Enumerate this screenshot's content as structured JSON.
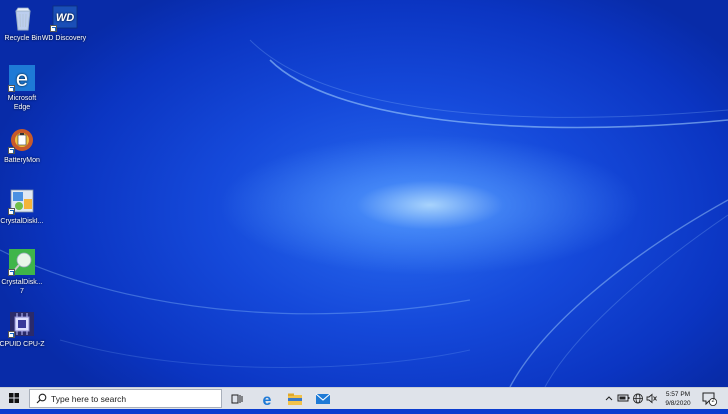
{
  "desktop": {
    "icons": [
      {
        "label": "Recycle Bin",
        "icon": "recycle-bin-icon"
      },
      {
        "label": "WD Discovery",
        "icon": "wd-discovery-icon"
      },
      {
        "label": "Microsoft Edge",
        "icon": "edge-icon"
      },
      {
        "label": "BatteryMon",
        "icon": "batterymon-icon"
      },
      {
        "label": "CrystalDiskI...",
        "icon": "crystaldiskinfo-icon"
      },
      {
        "label": "CrystalDisk... 7",
        "icon": "crystaldiskmark-icon"
      },
      {
        "label": "CPUID CPU-Z",
        "icon": "cpuz-icon"
      }
    ]
  },
  "taskbar": {
    "search_placeholder": "Type here to search",
    "pinned": [
      "task-view-icon",
      "edge-icon",
      "file-explorer-icon",
      "mail-icon"
    ],
    "clock": {
      "time": "5:57 PM",
      "date": "9/8/2020"
    },
    "notification_count": "2"
  },
  "colors": {
    "accent": "#0b35c2",
    "taskbar": "#dfe3ea"
  }
}
